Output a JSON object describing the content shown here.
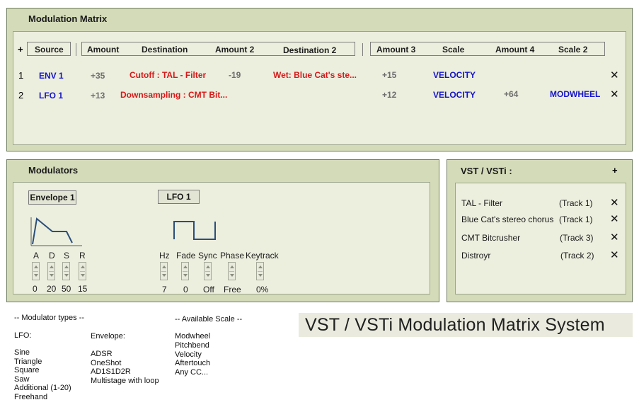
{
  "matrix": {
    "title": "Modulation Matrix",
    "add_label": "+",
    "headers": {
      "source": "Source",
      "amount": "Amount",
      "destination": "Destination",
      "amount2": "Amount 2",
      "destination2": "Destination 2",
      "amount3": "Amount 3",
      "scale": "Scale",
      "amount4": "Amount 4",
      "scale2": "Scale 2"
    },
    "rows": [
      {
        "index": "1",
        "source": "ENV 1",
        "amount": "+35",
        "destination": "Cutoff : TAL - Filter",
        "amount2": "-19",
        "destination2": "Wet: Blue Cat's ste...",
        "amount3": "+15",
        "scale": "VELOCITY",
        "amount4": "",
        "scale2": "",
        "close": "✕"
      },
      {
        "index": "2",
        "source": "LFO 1",
        "amount": "+13",
        "destination": "Downsampling : CMT Bit...",
        "amount2": "",
        "destination2": "",
        "amount3": "+12",
        "scale": "VELOCITY",
        "amount4": "+64",
        "scale2": "MODWHEEL",
        "close": "✕"
      }
    ]
  },
  "modulators": {
    "title": "Modulators",
    "envelope": {
      "button": "Envelope 1",
      "params": [
        {
          "label": "A",
          "value": "0"
        },
        {
          "label": "D",
          "value": "20"
        },
        {
          "label": "S",
          "value": "50"
        },
        {
          "label": "R",
          "value": "15"
        }
      ]
    },
    "lfo": {
      "button": "LFO 1",
      "params": [
        {
          "label": "Hz",
          "value": "7"
        },
        {
          "label": "Fade",
          "value": "0"
        },
        {
          "label": "Sync",
          "value": "Off"
        },
        {
          "label": "Phase",
          "value": "Free"
        },
        {
          "label": "Keytrack",
          "value": "0%"
        }
      ]
    }
  },
  "vst": {
    "title": "VST / VSTi :",
    "add_label": "+",
    "plugins": [
      {
        "name": "TAL - Filter",
        "track": "(Track 1)",
        "close": "✕"
      },
      {
        "name": "Blue Cat's stereo chorus",
        "track": "(Track 1)",
        "close": "✕"
      },
      {
        "name": "CMT Bitcrusher",
        "track": "(Track 3)",
        "close": "✕"
      },
      {
        "name": "Distroyr",
        "track": "(Track 2)",
        "close": "✕"
      }
    ]
  },
  "notes": {
    "modulator_types_heading": "-- Modulator types --",
    "lfo_heading": "LFO:",
    "lfo_types": [
      "Sine",
      "Triangle",
      "Square",
      "Saw",
      "Additional (1-20)",
      "Freehand"
    ],
    "envelope_heading": "Envelope:",
    "envelope_types": [
      "ADSR",
      "OneShot",
      "AD1S1D2R",
      "Multistage with loop"
    ],
    "scale_heading": "-- Available Scale --",
    "scales": [
      "Modwheel",
      "Pitchbend",
      "Velocity",
      "Aftertouch",
      "Any CC..."
    ]
  },
  "banner": {
    "text": "VST / VSTi Modulation Matrix System"
  },
  "colors": {
    "panel_bg": "#d4dbb9",
    "inner_bg": "#eceede",
    "source_blue": "#1414c8",
    "destination_red": "#d81818",
    "amount_gray": "#6e6e6e",
    "graph_blue": "#2a4f7a"
  }
}
